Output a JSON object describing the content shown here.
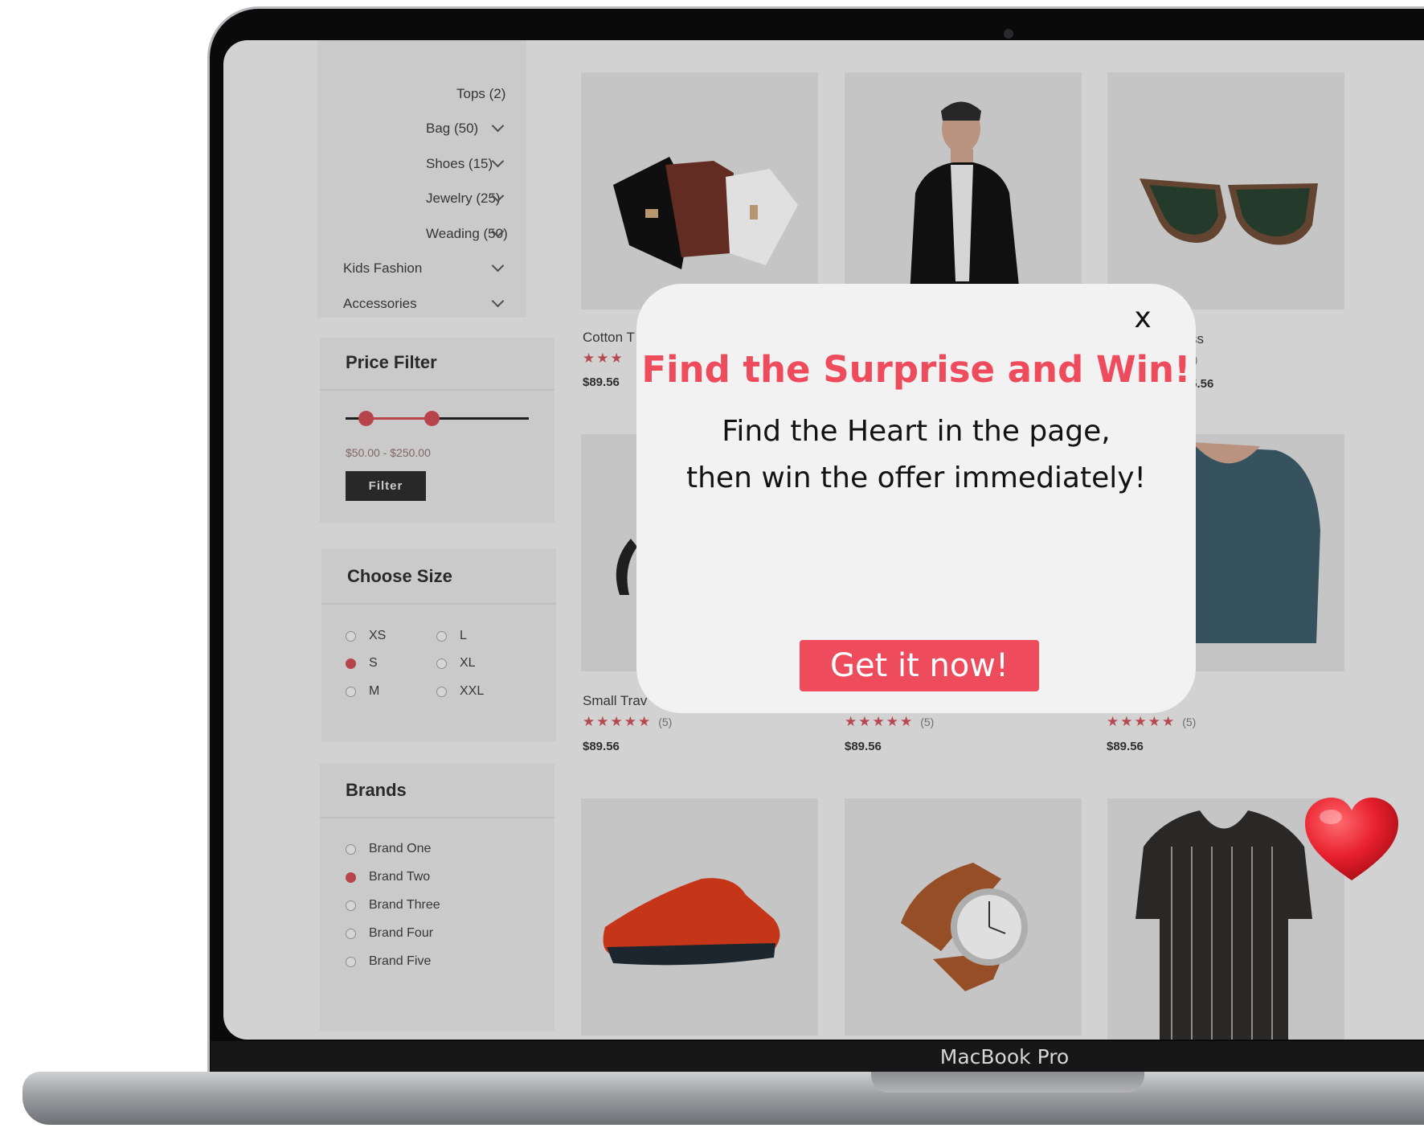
{
  "device_label": "MacBook Pro",
  "categories": [
    {
      "label": "Tops (2)",
      "has_chevron": false
    },
    {
      "label": "Bag (50)",
      "has_chevron": true
    },
    {
      "label": "Shoes (15)",
      "has_chevron": true
    },
    {
      "label": "Jewelry (25)",
      "has_chevron": true
    },
    {
      "label": "Weading (50)",
      "has_chevron": true
    },
    {
      "label": "Kids Fashion",
      "has_chevron": true
    },
    {
      "label": "Accessories",
      "has_chevron": true
    }
  ],
  "price_filter": {
    "title": "Price Filter",
    "range_label": "$50.00 - $250.00",
    "button": "Filter"
  },
  "size_filter": {
    "title": "Choose Size",
    "options": [
      {
        "label": "XS",
        "selected": false
      },
      {
        "label": "S",
        "selected": true
      },
      {
        "label": "M",
        "selected": false
      },
      {
        "label": "L",
        "selected": false
      },
      {
        "label": "XL",
        "selected": false
      },
      {
        "label": "XXL",
        "selected": false
      }
    ]
  },
  "brands": {
    "title": "Brands",
    "options": [
      {
        "label": "Brand One",
        "selected": false
      },
      {
        "label": "Brand Two",
        "selected": true
      },
      {
        "label": "Brand Three",
        "selected": false
      },
      {
        "label": "Brand Four",
        "selected": false
      },
      {
        "label": "Brand Five",
        "selected": false
      }
    ]
  },
  "products_row1": [
    {
      "name": "Cotton T",
      "stars": "★★★",
      "count": "",
      "price": "$89.56"
    },
    {
      "name": "",
      "stars": "",
      "count": "",
      "price": ""
    },
    {
      "name": "ss",
      "stars": "",
      "count": "1)",
      "price": ".5.56"
    }
  ],
  "products_row2": [
    {
      "name": "Small Trav",
      "stars": "★★★★★",
      "count": "(5)",
      "price": "$89.56"
    },
    {
      "name": "",
      "stars": "★★★★★",
      "count": "(5)",
      "price": "$89.56"
    },
    {
      "name": "",
      "stars": "★★★★★",
      "count": "(5)",
      "price": "$89.56"
    }
  ],
  "modal": {
    "close_label": "x",
    "title": "Find the Surprise and Win!",
    "body_line1": "Find the Heart in the page,",
    "body_line2": "then win the offer immediately!",
    "cta": "Get it now!"
  },
  "colors": {
    "accent": "#ee4c5d",
    "heart": "#e8202d",
    "modal_bg": "#f2f2f2"
  },
  "icons": {
    "close": "close-icon",
    "heart": "heart-icon",
    "chevron": "chevron-down-icon"
  }
}
